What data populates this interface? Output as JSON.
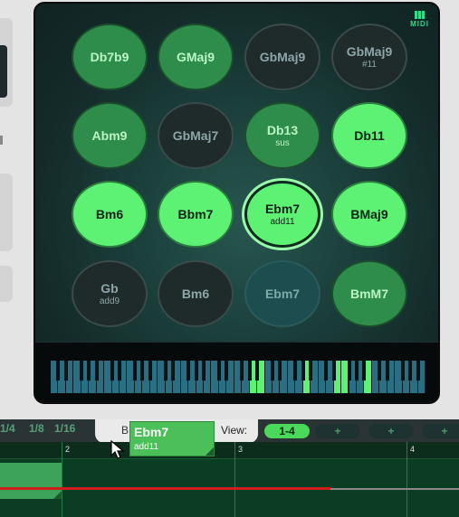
{
  "midi_label": "MIDI",
  "pads": [
    {
      "name": "Db7b9",
      "sub": "",
      "state": "mid"
    },
    {
      "name": "GMaj9",
      "sub": "",
      "state": "mid"
    },
    {
      "name": "GbMaj9",
      "sub": "",
      "state": "dark"
    },
    {
      "name": "GbMaj9",
      "sub": "#11",
      "state": "dark"
    },
    {
      "name": "Abm9",
      "sub": "",
      "state": "mid"
    },
    {
      "name": "GbMaj7",
      "sub": "",
      "state": "dark"
    },
    {
      "name": "Db13",
      "sub": "sus",
      "state": "mid"
    },
    {
      "name": "Db11",
      "sub": "",
      "state": "bright"
    },
    {
      "name": "Bm6",
      "sub": "",
      "state": "bright"
    },
    {
      "name": "Bbm7",
      "sub": "",
      "state": "bright"
    },
    {
      "name": "Ebm7",
      "sub": "add11",
      "state": "selected"
    },
    {
      "name": "BMaj9",
      "sub": "",
      "state": "bright"
    },
    {
      "name": "Gb",
      "sub": "add9",
      "state": "dark"
    },
    {
      "name": "Bm6",
      "sub": "",
      "state": "dark"
    },
    {
      "name": "Ebm7",
      "sub": "",
      "state": "teal"
    },
    {
      "name": "BmM7",
      "sub": "",
      "state": "mid"
    }
  ],
  "keyboard": {
    "white_keys": 49,
    "active_keys": [
      26,
      27,
      33,
      37,
      38,
      41
    ]
  },
  "quantize": [
    "1/4",
    "1/8",
    "1/16"
  ],
  "b_label": "B",
  "view_label": "View:",
  "view_buttons": [
    "1-4",
    "+",
    "+",
    "+"
  ],
  "timeline": {
    "bar_numbers": [
      "2",
      "3",
      "4"
    ]
  },
  "drag_chip": {
    "name": "Ebm7",
    "sub": "add11"
  }
}
